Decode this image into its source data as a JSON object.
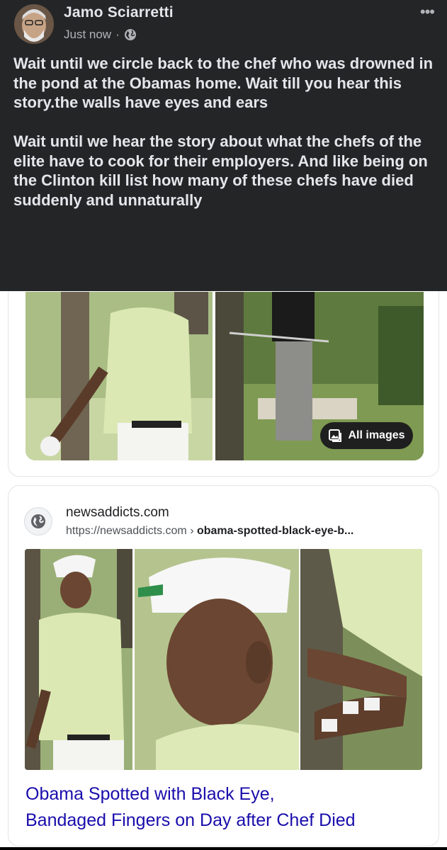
{
  "post": {
    "author_name": "Jamo Sciarretti",
    "timestamp": "Just now",
    "separator": "·",
    "privacy_icon": "globe-icon",
    "more_label": "•••",
    "paragraph_1": "Wait until we circle back to the chef who was drowned in the pond at the Obamas home. Wait till you hear this story.the walls have eyes and ears",
    "paragraph_2": "Wait until we hear the story about what the chefs of the elite have to cook for their employers. And like being on the Clinton kill list how many of these chefs have died suddenly and unnaturally"
  },
  "image_results": {
    "all_images_label": "All images",
    "all_images_icon": "images-icon"
  },
  "result": {
    "site_name": "newsaddicts.com",
    "url_base": "https://newsaddicts.com › ",
    "url_path": "obama-spotted-black-eye-b...",
    "favicon": "globe-icon",
    "title_line_1": "Obama Spotted with Black Eye,",
    "title_line_2": "Bandaged Fingers on Day after Chef Died"
  },
  "colors": {
    "post_background": "#242526",
    "post_text": "#e4e6eb",
    "link_title": "#1a0dab"
  }
}
